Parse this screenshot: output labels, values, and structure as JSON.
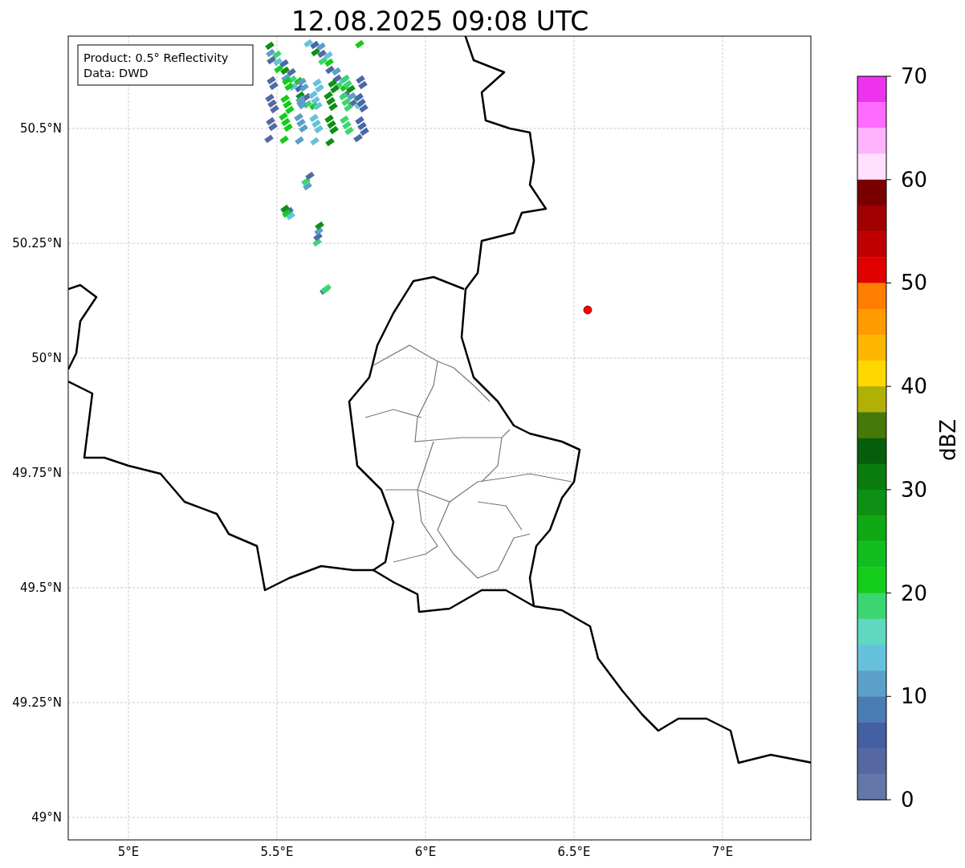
{
  "title": "12.08.2025 09:08 UTC",
  "info_box": [
    "Product: 0.5° Reflectivity",
    "Data: DWD"
  ],
  "map": {
    "x_ticks": [
      "5°E",
      "5.5°E",
      "6°E",
      "6.5°E",
      "7°E"
    ],
    "y_ticks": [
      "50.5°N",
      "50.25°N",
      "50°N",
      "49.75°N",
      "49.5°N",
      "49.25°N",
      "49°N"
    ]
  },
  "colorbar": {
    "label": "dBZ",
    "ticks": [
      "70",
      "60",
      "50",
      "40",
      "30",
      "20",
      "10",
      "0"
    ],
    "bins": [
      {
        "color": "#ee33ee"
      },
      {
        "color": "#ff6bff"
      },
      {
        "color": "#ffb3ff"
      },
      {
        "color": "#ffe0ff"
      },
      {
        "color": "#7a0000"
      },
      {
        "color": "#a00000"
      },
      {
        "color": "#c00000"
      },
      {
        "color": "#e00000"
      },
      {
        "color": "#ff7d00"
      },
      {
        "color": "#ff9a00"
      },
      {
        "color": "#ffb600"
      },
      {
        "color": "#ffd800"
      },
      {
        "color": "#b0b005"
      },
      {
        "color": "#46780a"
      },
      {
        "color": "#075e0a"
      },
      {
        "color": "#0b7c10"
      },
      {
        "color": "#0d9014"
      },
      {
        "color": "#0fa915"
      },
      {
        "color": "#12be1f"
      },
      {
        "color": "#14cc1a"
      },
      {
        "color": "#3dd570"
      },
      {
        "color": "#5fd8c0"
      },
      {
        "color": "#66c2dc"
      },
      {
        "color": "#5ba0c8"
      },
      {
        "color": "#4a7cb4"
      },
      {
        "color": "#4460a3"
      },
      {
        "color": "#5568a2"
      },
      {
        "color": "#6577a8"
      }
    ]
  }
}
